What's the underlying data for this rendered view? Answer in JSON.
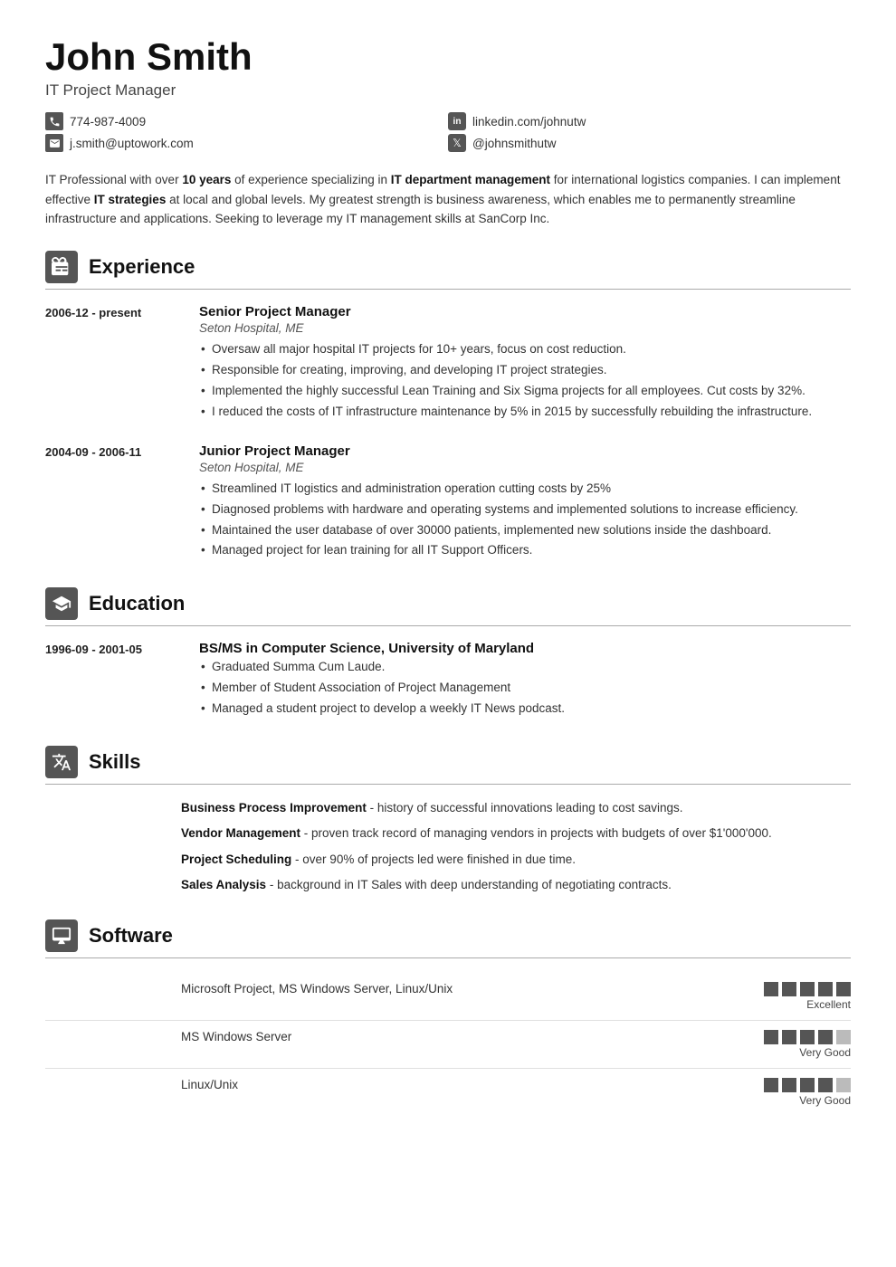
{
  "header": {
    "name": "John Smith",
    "title": "IT Project Manager",
    "contact": [
      {
        "type": "phone",
        "icon": "☎",
        "value": "774-987-4009"
      },
      {
        "type": "linkedin",
        "icon": "in",
        "value": "linkedin.com/johnutw"
      },
      {
        "type": "email",
        "icon": "✉",
        "value": "j.smith@uptowork.com"
      },
      {
        "type": "twitter",
        "icon": "🐦",
        "value": "@johnsmithutw"
      }
    ]
  },
  "summary": {
    "text_parts": [
      {
        "t": "IT Professional with over ",
        "bold": false
      },
      {
        "t": "10 years",
        "bold": true
      },
      {
        "t": " of experience specializing in ",
        "bold": false
      },
      {
        "t": "IT department management",
        "bold": true
      },
      {
        "t": " for international logistics companies. I can implement effective ",
        "bold": false
      },
      {
        "t": "IT strategies",
        "bold": true
      },
      {
        "t": " at local and global levels. My greatest strength is business awareness, which enables me to permanently streamline infrastructure and applications. Seeking to leverage my IT management skills at SanCorp Inc.",
        "bold": false
      }
    ]
  },
  "sections": {
    "experience": {
      "title": "Experience",
      "entries": [
        {
          "dates": "2006-12 - present",
          "title": "Senior Project Manager",
          "subtitle": "Seton Hospital, ME",
          "bullets": [
            "Oversaw all major hospital IT projects for 10+ years, focus on cost reduction.",
            "Responsible for creating, improving, and developing IT project strategies.",
            "Implemented the highly successful Lean Training and Six Sigma projects for all employees. Cut costs by 32%.",
            "I reduced the costs of IT infrastructure maintenance by 5% in 2015 by successfully rebuilding the infrastructure."
          ]
        },
        {
          "dates": "2004-09 - 2006-11",
          "title": "Junior Project Manager",
          "subtitle": "Seton Hospital, ME",
          "bullets": [
            "Streamlined IT logistics and administration operation cutting costs by 25%",
            "Diagnosed problems with hardware and operating systems and implemented solutions to increase efficiency.",
            "Maintained the user database of over 30000 patients, implemented new solutions inside the dashboard.",
            "Managed project for lean training for all IT Support Officers."
          ]
        }
      ]
    },
    "education": {
      "title": "Education",
      "entries": [
        {
          "dates": "1996-09 - 2001-05",
          "title": "BS/MS in Computer Science, University of Maryland",
          "subtitle": "",
          "bullets": [
            "Graduated Summa Cum Laude.",
            "Member of Student Association of Project Management",
            "Managed a student project to develop a weekly IT News podcast."
          ]
        }
      ]
    },
    "skills": {
      "title": "Skills",
      "items": [
        {
          "name": "Business Process Improvement",
          "desc": "history of successful innovations leading to cost savings."
        },
        {
          "name": "Vendor Management",
          "desc": "proven track record of managing vendors in projects with budgets of over $1'000'000."
        },
        {
          "name": "Project Scheduling",
          "desc": "over 90% of projects led were finished in due time."
        },
        {
          "name": "Sales Analysis",
          "desc": "background in IT Sales with deep understanding of negotiating contracts."
        }
      ]
    },
    "software": {
      "title": "Software",
      "items": [
        {
          "name": "Microsoft Project, MS Windows Server, Linux/Unix",
          "rating": 5,
          "label": "Excellent"
        },
        {
          "name": "MS Windows Server",
          "rating": 4,
          "label": "Very Good"
        },
        {
          "name": "Linux/Unix",
          "rating": 4,
          "label": "Very Good"
        }
      ],
      "max_dots": 5
    }
  }
}
